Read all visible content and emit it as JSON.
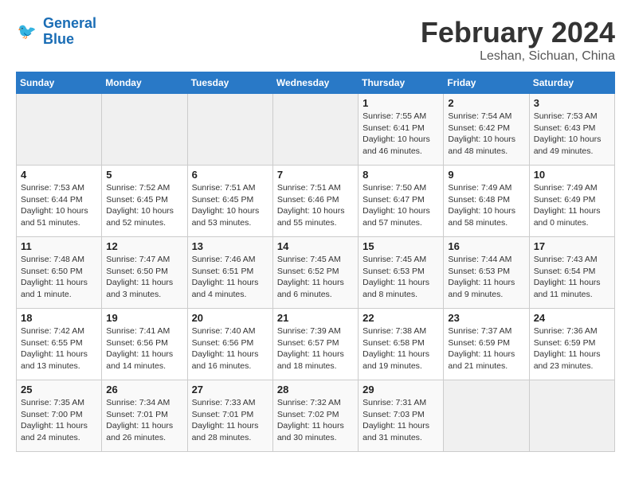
{
  "logo": {
    "line1": "General",
    "line2": "Blue"
  },
  "title": "February 2024",
  "location": "Leshan, Sichuan, China",
  "days_of_week": [
    "Sunday",
    "Monday",
    "Tuesday",
    "Wednesday",
    "Thursday",
    "Friday",
    "Saturday"
  ],
  "weeks": [
    [
      {
        "day": "",
        "info": ""
      },
      {
        "day": "",
        "info": ""
      },
      {
        "day": "",
        "info": ""
      },
      {
        "day": "",
        "info": ""
      },
      {
        "day": "1",
        "info": "Sunrise: 7:55 AM\nSunset: 6:41 PM\nDaylight: 10 hours\nand 46 minutes."
      },
      {
        "day": "2",
        "info": "Sunrise: 7:54 AM\nSunset: 6:42 PM\nDaylight: 10 hours\nand 48 minutes."
      },
      {
        "day": "3",
        "info": "Sunrise: 7:53 AM\nSunset: 6:43 PM\nDaylight: 10 hours\nand 49 minutes."
      }
    ],
    [
      {
        "day": "4",
        "info": "Sunrise: 7:53 AM\nSunset: 6:44 PM\nDaylight: 10 hours\nand 51 minutes."
      },
      {
        "day": "5",
        "info": "Sunrise: 7:52 AM\nSunset: 6:45 PM\nDaylight: 10 hours\nand 52 minutes."
      },
      {
        "day": "6",
        "info": "Sunrise: 7:51 AM\nSunset: 6:45 PM\nDaylight: 10 hours\nand 53 minutes."
      },
      {
        "day": "7",
        "info": "Sunrise: 7:51 AM\nSunset: 6:46 PM\nDaylight: 10 hours\nand 55 minutes."
      },
      {
        "day": "8",
        "info": "Sunrise: 7:50 AM\nSunset: 6:47 PM\nDaylight: 10 hours\nand 57 minutes."
      },
      {
        "day": "9",
        "info": "Sunrise: 7:49 AM\nSunset: 6:48 PM\nDaylight: 10 hours\nand 58 minutes."
      },
      {
        "day": "10",
        "info": "Sunrise: 7:49 AM\nSunset: 6:49 PM\nDaylight: 11 hours\nand 0 minutes."
      }
    ],
    [
      {
        "day": "11",
        "info": "Sunrise: 7:48 AM\nSunset: 6:50 PM\nDaylight: 11 hours\nand 1 minute."
      },
      {
        "day": "12",
        "info": "Sunrise: 7:47 AM\nSunset: 6:50 PM\nDaylight: 11 hours\nand 3 minutes."
      },
      {
        "day": "13",
        "info": "Sunrise: 7:46 AM\nSunset: 6:51 PM\nDaylight: 11 hours\nand 4 minutes."
      },
      {
        "day": "14",
        "info": "Sunrise: 7:45 AM\nSunset: 6:52 PM\nDaylight: 11 hours\nand 6 minutes."
      },
      {
        "day": "15",
        "info": "Sunrise: 7:45 AM\nSunset: 6:53 PM\nDaylight: 11 hours\nand 8 minutes."
      },
      {
        "day": "16",
        "info": "Sunrise: 7:44 AM\nSunset: 6:53 PM\nDaylight: 11 hours\nand 9 minutes."
      },
      {
        "day": "17",
        "info": "Sunrise: 7:43 AM\nSunset: 6:54 PM\nDaylight: 11 hours\nand 11 minutes."
      }
    ],
    [
      {
        "day": "18",
        "info": "Sunrise: 7:42 AM\nSunset: 6:55 PM\nDaylight: 11 hours\nand 13 minutes."
      },
      {
        "day": "19",
        "info": "Sunrise: 7:41 AM\nSunset: 6:56 PM\nDaylight: 11 hours\nand 14 minutes."
      },
      {
        "day": "20",
        "info": "Sunrise: 7:40 AM\nSunset: 6:56 PM\nDaylight: 11 hours\nand 16 minutes."
      },
      {
        "day": "21",
        "info": "Sunrise: 7:39 AM\nSunset: 6:57 PM\nDaylight: 11 hours\nand 18 minutes."
      },
      {
        "day": "22",
        "info": "Sunrise: 7:38 AM\nSunset: 6:58 PM\nDaylight: 11 hours\nand 19 minutes."
      },
      {
        "day": "23",
        "info": "Sunrise: 7:37 AM\nSunset: 6:59 PM\nDaylight: 11 hours\nand 21 minutes."
      },
      {
        "day": "24",
        "info": "Sunrise: 7:36 AM\nSunset: 6:59 PM\nDaylight: 11 hours\nand 23 minutes."
      }
    ],
    [
      {
        "day": "25",
        "info": "Sunrise: 7:35 AM\nSunset: 7:00 PM\nDaylight: 11 hours\nand 24 minutes."
      },
      {
        "day": "26",
        "info": "Sunrise: 7:34 AM\nSunset: 7:01 PM\nDaylight: 11 hours\nand 26 minutes."
      },
      {
        "day": "27",
        "info": "Sunrise: 7:33 AM\nSunset: 7:01 PM\nDaylight: 11 hours\nand 28 minutes."
      },
      {
        "day": "28",
        "info": "Sunrise: 7:32 AM\nSunset: 7:02 PM\nDaylight: 11 hours\nand 30 minutes."
      },
      {
        "day": "29",
        "info": "Sunrise: 7:31 AM\nSunset: 7:03 PM\nDaylight: 11 hours\nand 31 minutes."
      },
      {
        "day": "",
        "info": ""
      },
      {
        "day": "",
        "info": ""
      }
    ]
  ]
}
